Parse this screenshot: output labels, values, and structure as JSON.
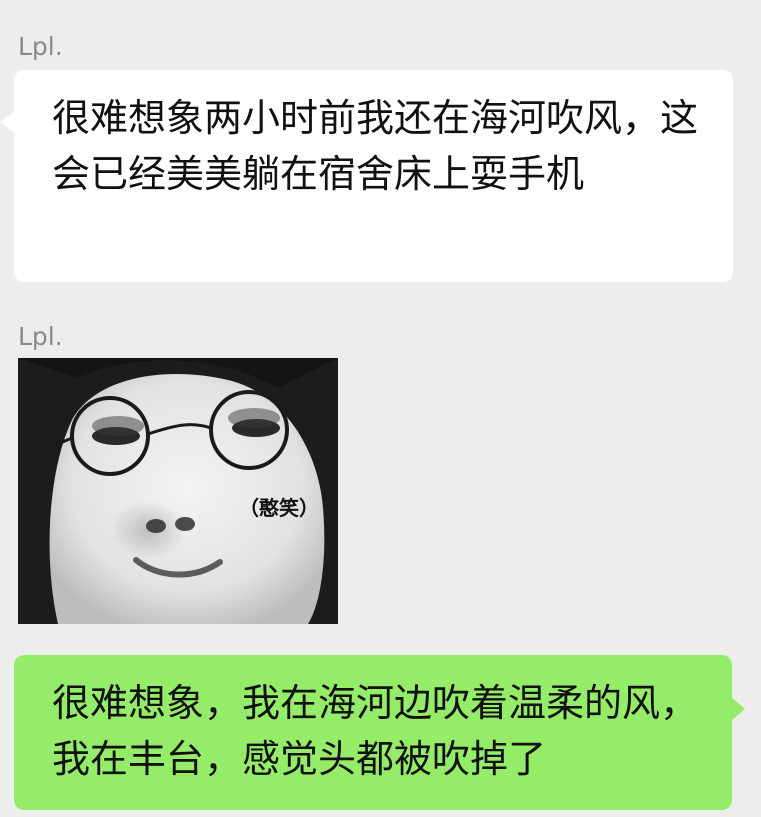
{
  "messages": [
    {
      "sender": "Lpl.",
      "type": "text",
      "direction": "incoming",
      "text": "很难想象两小时前我还在海河吹风，这会已经美美躺在宿舍床上耍手机"
    },
    {
      "sender": "Lpl.",
      "type": "sticker",
      "direction": "incoming",
      "caption": "（憨笑）"
    },
    {
      "type": "text",
      "direction": "outgoing",
      "text": "很难想象，我在海河边吹着温柔的风，我在丰台，感觉头都被吹掉了"
    }
  ],
  "colors": {
    "background": "#ededed",
    "incoming_bubble": "#ffffff",
    "outgoing_bubble": "#95ec69",
    "sender_name": "#8a8a8a",
    "text": "#111111"
  }
}
